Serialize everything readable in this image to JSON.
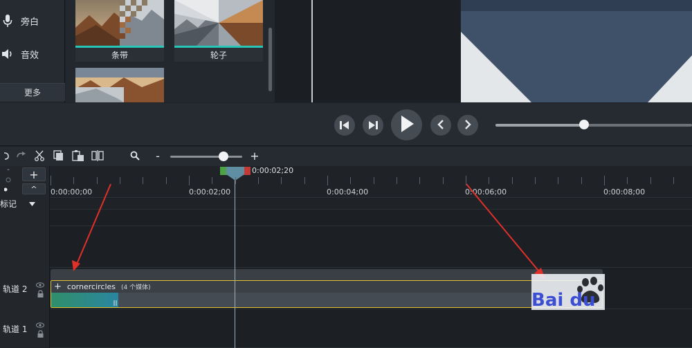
{
  "sidebar": {
    "items": [
      {
        "label": "旁白",
        "icon": "microphone-icon"
      },
      {
        "label": "音效",
        "icon": "speaker-icon"
      }
    ],
    "more_label": "更多"
  },
  "transitions": [
    {
      "label": "条带"
    },
    {
      "label": "轮子"
    }
  ],
  "transport": {
    "buttons": [
      "step-back-icon",
      "step-forward-icon",
      "play-icon",
      "previous-icon",
      "next-icon"
    ],
    "progress_fraction": 0.45
  },
  "toolbar": {
    "icons": [
      "undo-icon",
      "redo-icon",
      "cut-icon",
      "copy-icon",
      "paste-icon",
      "split-icon",
      "zoom-search-icon"
    ],
    "zoom_minus": "-",
    "zoom_plus": "+",
    "zoom_fraction": 0.74
  },
  "timeline": {
    "add_track_label": "+",
    "collapse_label": "^",
    "marker_label": "标记",
    "playhead_time": "0:00:02;20",
    "ruler_labels": [
      "0:00:00;00",
      "0:00:02;00",
      "0:00:04;00",
      "0:00:06;00",
      "0:00:08;00"
    ],
    "tracks": [
      {
        "label": "轨道 2"
      },
      {
        "label": "轨道 1"
      }
    ],
    "clip": {
      "plus": "+",
      "name": "cornercircles",
      "count": "(4 个媒体)"
    }
  },
  "watermark": {
    "text": "Bai du"
  },
  "colors": {
    "accent_teal": "#26c6b9",
    "clip_border": "#e4c230",
    "annotation_arrow": "#e0302a"
  }
}
